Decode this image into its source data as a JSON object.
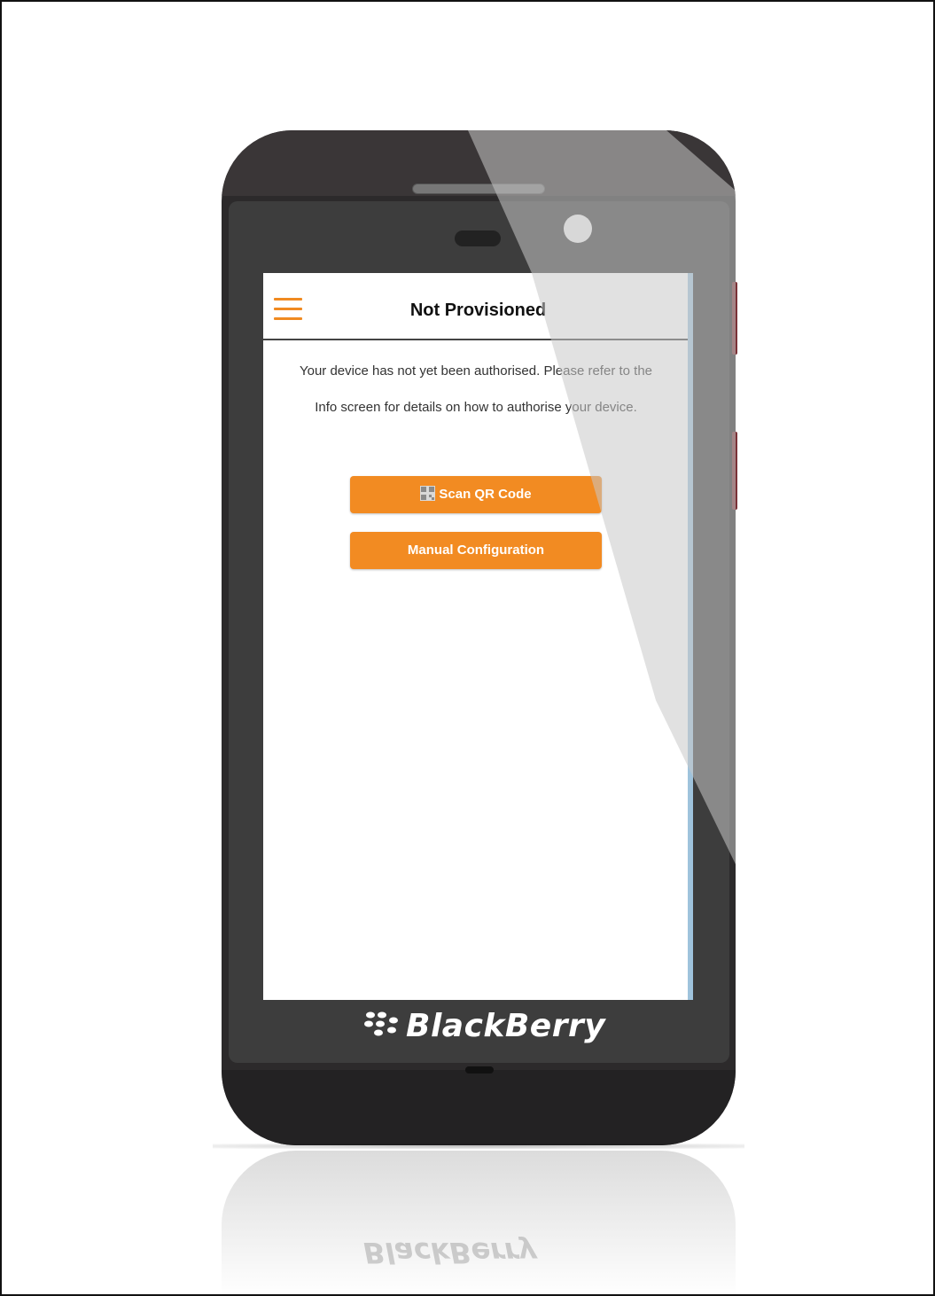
{
  "device": {
    "brand": "BlackBerry"
  },
  "app": {
    "title": "Not Provisioned",
    "message": "Your device has not yet been authorised. Please refer to the Info screen for details on how to authorise your device.",
    "buttons": {
      "scan_qr": "Scan QR Code",
      "manual_config": "Manual Configuration"
    }
  },
  "icons": {
    "menu": "hamburger-menu-icon",
    "qr": "qr-code-icon",
    "brand": "blackberry-logo-icon"
  },
  "colors": {
    "accent": "#f28b22",
    "phone_body": "#2c2a2b",
    "screen_bg": "#ffffff"
  }
}
